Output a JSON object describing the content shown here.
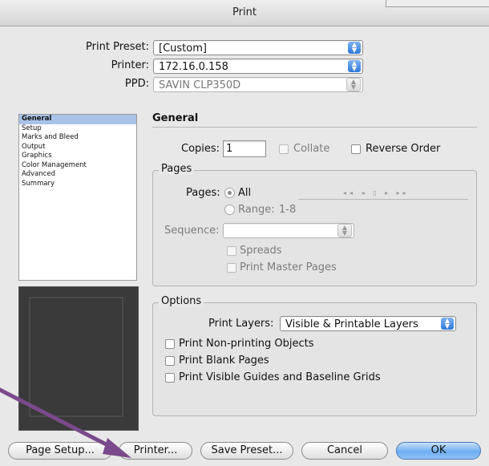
{
  "window": {
    "title": "Print"
  },
  "preset": {
    "label": "Print Preset:",
    "value": "[Custom]"
  },
  "printer": {
    "label": "Printer:",
    "value": "172.16.0.158"
  },
  "ppd": {
    "label": "PPD:",
    "value": "SAVIN CLP350D"
  },
  "sidebar": {
    "items": [
      {
        "label": "General",
        "selected": true
      },
      {
        "label": "Setup"
      },
      {
        "label": "Marks and Bleed"
      },
      {
        "label": "Output"
      },
      {
        "label": "Graphics"
      },
      {
        "label": "Color Management"
      },
      {
        "label": "Advanced"
      },
      {
        "label": "Summary"
      }
    ]
  },
  "general": {
    "title": "General",
    "copies_label": "Copies:",
    "copies_value": "1",
    "collate_label": "Collate",
    "reverse_label": "Reverse Order"
  },
  "pages": {
    "group_label": "Pages",
    "pages_label": "Pages:",
    "all_label": "All",
    "range_label": "Range:",
    "range_value": "1-8",
    "nav_icons": "◂◂ ◂ ▯ ▸ ▸▸",
    "sequence_label": "Sequence:",
    "sequence_value": "",
    "spreads_label": "Spreads",
    "master_label": "Print Master Pages"
  },
  "options": {
    "group_label": "Options",
    "layers_label": "Print Layers:",
    "layers_value": "Visible & Printable Layers",
    "nonprinting_label": "Print Non-printing Objects",
    "blank_label": "Print Blank Pages",
    "guides_label": "Print Visible Guides and Baseline Grids"
  },
  "buttons": {
    "page_setup": "Page Setup...",
    "printer": "Printer...",
    "save_preset": "Save Preset...",
    "cancel": "Cancel",
    "ok": "OK"
  },
  "colors": {
    "accent": "#6eaef0",
    "annotation_arrow": "#7a4a8c",
    "selection": "#a9c3e8"
  }
}
